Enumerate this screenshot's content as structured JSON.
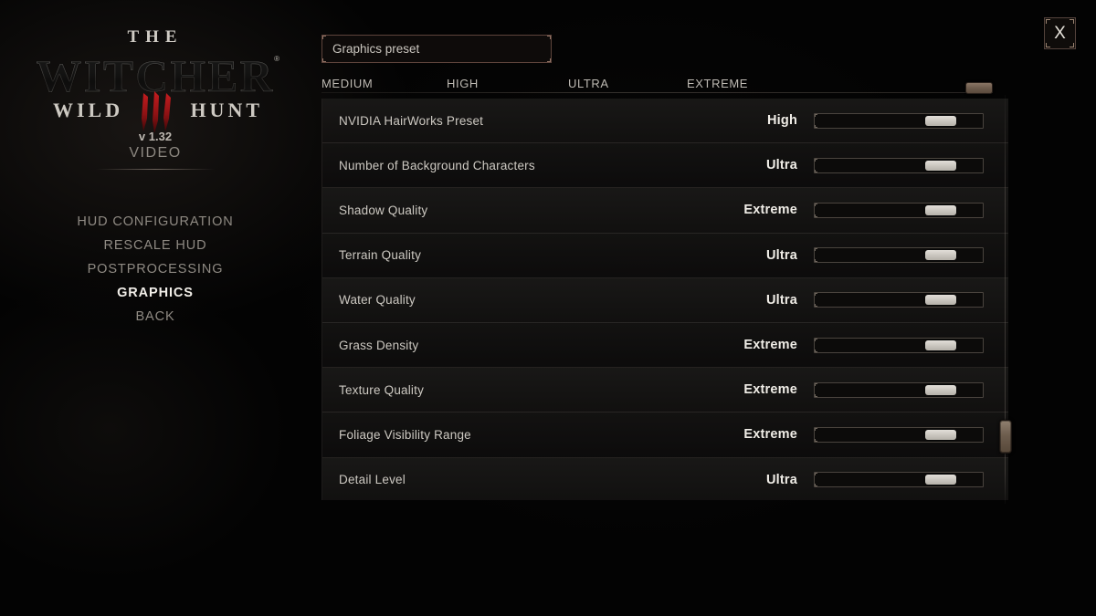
{
  "window": {
    "close_label": "X"
  },
  "branding": {
    "the": "THE",
    "witcher": "WITCHER",
    "wild": "WILD",
    "hunt": "HUNT",
    "registered_mark": "®",
    "version": "v 1.32",
    "section": "VIDEO",
    "claw_color": "#8e1214"
  },
  "menu": {
    "items": [
      {
        "label": "HUD CONFIGURATION",
        "active": false
      },
      {
        "label": "RESCALE HUD",
        "active": false
      },
      {
        "label": "POSTPROCESSING",
        "active": false
      },
      {
        "label": "GRAPHICS",
        "active": true
      },
      {
        "label": "BACK",
        "active": false
      }
    ]
  },
  "preset": {
    "label": "Graphics preset",
    "ticks": [
      "MEDIUM",
      "HIGH",
      "ULTRA",
      "EXTREME"
    ],
    "selected": "EXTREME",
    "thumb_percent": 100,
    "thumb_color": "#6c5a4b",
    "border_color": "#5e443c"
  },
  "settings": {
    "rows": [
      {
        "name": "NVIDIA HairWorks Preset",
        "value": "High",
        "slider_percent": 80
      },
      {
        "name": "Number of Background Characters",
        "value": "Ultra",
        "slider_percent": 80
      },
      {
        "name": "Shadow Quality",
        "value": "Extreme",
        "slider_percent": 80
      },
      {
        "name": "Terrain Quality",
        "value": "Ultra",
        "slider_percent": 80
      },
      {
        "name": "Water Quality",
        "value": "Ultra",
        "slider_percent": 80
      },
      {
        "name": "Grass Density",
        "value": "Extreme",
        "slider_percent": 80
      },
      {
        "name": "Texture Quality",
        "value": "Extreme",
        "slider_percent": 80
      },
      {
        "name": "Foliage Visibility Range",
        "value": "Extreme",
        "slider_percent": 80
      },
      {
        "name": "Detail Level",
        "value": "Ultra",
        "slider_percent": 80
      }
    ]
  },
  "scrollbar": {
    "thumb_position_percent": 80,
    "thumb_color": "#6d5d4e"
  }
}
